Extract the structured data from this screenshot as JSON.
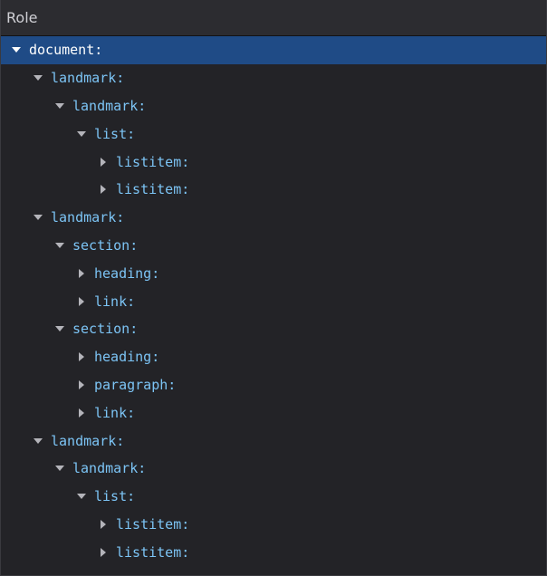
{
  "header": {
    "title": "Role"
  },
  "tree": {
    "rows": [
      {
        "label": "document:",
        "depth": 0,
        "expanded": true,
        "selected": true
      },
      {
        "label": "landmark:",
        "depth": 1,
        "expanded": true,
        "selected": false
      },
      {
        "label": "landmark:",
        "depth": 2,
        "expanded": true,
        "selected": false
      },
      {
        "label": "list:",
        "depth": 3,
        "expanded": true,
        "selected": false
      },
      {
        "label": "listitem:",
        "depth": 4,
        "expanded": false,
        "selected": false
      },
      {
        "label": "listitem:",
        "depth": 4,
        "expanded": false,
        "selected": false
      },
      {
        "label": "landmark:",
        "depth": 1,
        "expanded": true,
        "selected": false
      },
      {
        "label": "section:",
        "depth": 2,
        "expanded": true,
        "selected": false
      },
      {
        "label": "heading:",
        "depth": 3,
        "expanded": false,
        "selected": false
      },
      {
        "label": "link:",
        "depth": 3,
        "expanded": false,
        "selected": false
      },
      {
        "label": "section:",
        "depth": 2,
        "expanded": true,
        "selected": false
      },
      {
        "label": "heading:",
        "depth": 3,
        "expanded": false,
        "selected": false
      },
      {
        "label": "paragraph:",
        "depth": 3,
        "expanded": false,
        "selected": false
      },
      {
        "label": "link:",
        "depth": 3,
        "expanded": false,
        "selected": false
      },
      {
        "label": "landmark:",
        "depth": 1,
        "expanded": true,
        "selected": false
      },
      {
        "label": "landmark:",
        "depth": 2,
        "expanded": true,
        "selected": false
      },
      {
        "label": "list:",
        "depth": 3,
        "expanded": true,
        "selected": false
      },
      {
        "label": "listitem:",
        "depth": 4,
        "expanded": false,
        "selected": false
      },
      {
        "label": "listitem:",
        "depth": 4,
        "expanded": false,
        "selected": false
      }
    ]
  },
  "colors": {
    "background": "#232327",
    "selected_row": "#1f4b86",
    "label_text": "#7cc4f5",
    "twisty": "#b4b4ba",
    "twisty_selected": "#ffffff"
  }
}
